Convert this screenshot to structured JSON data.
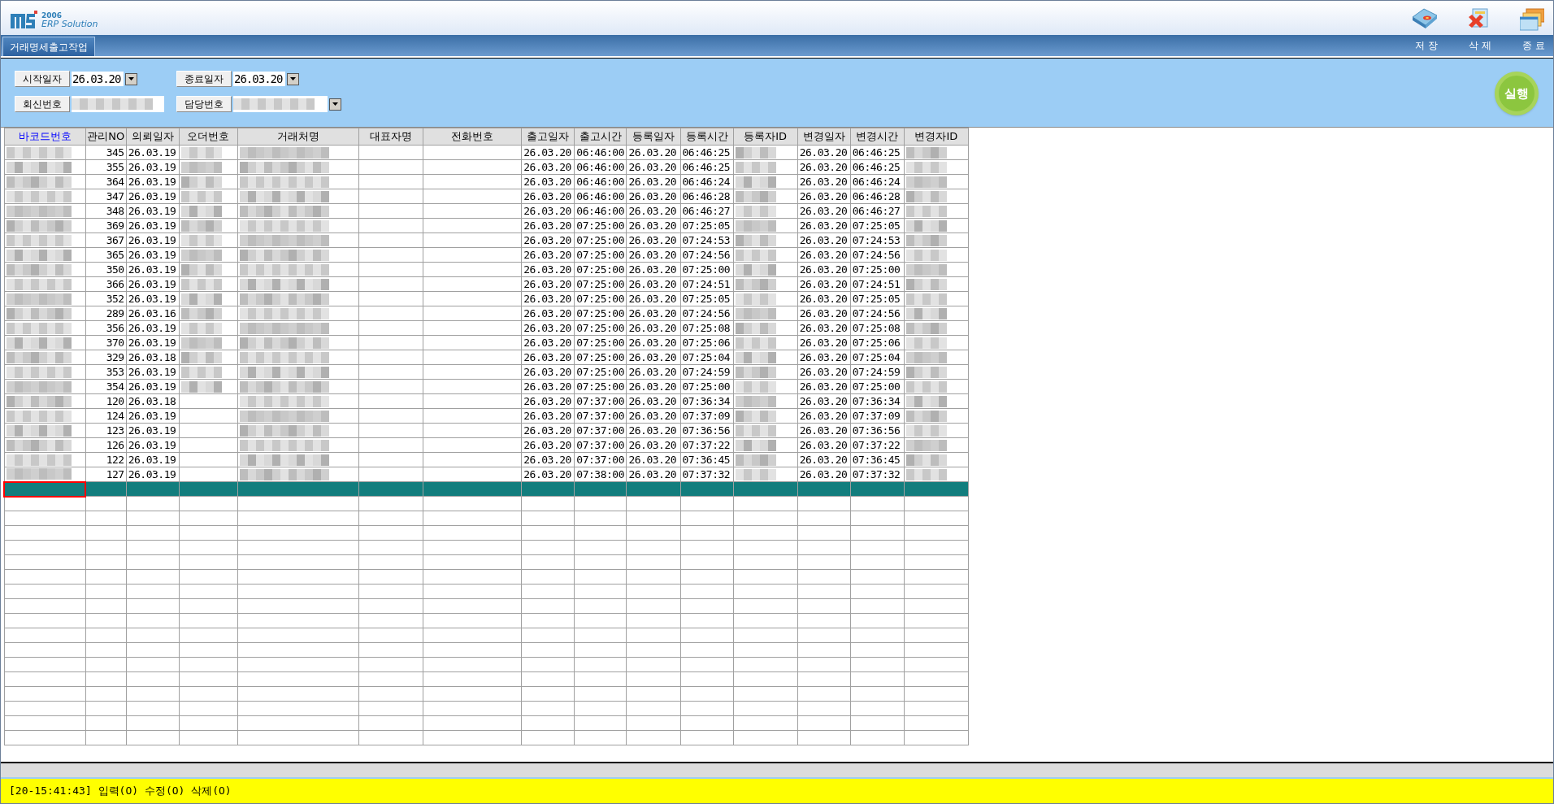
{
  "logo": {
    "year": "2006",
    "text": "ERP Solution"
  },
  "toolbar": [
    {
      "kind": "save",
      "label": "저 장"
    },
    {
      "kind": "delete",
      "label": "삭 제"
    },
    {
      "kind": "exit",
      "label": "종 료"
    }
  ],
  "tab": {
    "label": "거래명세출고작업",
    "selected": true
  },
  "filters": {
    "start_date": {
      "label": "시작일자",
      "value": "26.03.20"
    },
    "end_date": {
      "label": "종료일자",
      "value": "26.03.20"
    },
    "reply_no": {
      "label": "회신번호",
      "masked": true
    },
    "manager_no": {
      "label": "담당번호",
      "masked": true
    }
  },
  "run_button": {
    "label": "실행"
  },
  "table": {
    "columns": [
      {
        "label": "바코드번호",
        "key": true,
        "kind": "masked"
      },
      {
        "label": "관리NO",
        "kind": "number"
      },
      {
        "label": "의뢰일자",
        "kind": "text"
      },
      {
        "label": "오더번호",
        "kind": "order"
      },
      {
        "label": "거래처명",
        "kind": "masked"
      },
      {
        "label": "대표자명",
        "kind": "text"
      },
      {
        "label": "전화번호",
        "kind": "text"
      },
      {
        "label": "출고일자",
        "kind": "text"
      },
      {
        "label": "출고시간",
        "kind": "text"
      },
      {
        "label": "등록일자",
        "kind": "text"
      },
      {
        "label": "등록시간",
        "kind": "text"
      },
      {
        "label": "등록자ID",
        "kind": "masked"
      },
      {
        "label": "변경일자",
        "kind": "text"
      },
      {
        "label": "변경시간",
        "kind": "text"
      },
      {
        "label": "변경자ID",
        "kind": "masked"
      }
    ],
    "rows": [
      {
        "order_masked": true,
        "cells": [
          "",
          "345",
          "26.03.19",
          "",
          "",
          "",
          "",
          "26.03.20",
          "06:46:00",
          "26.03.20",
          "06:46:25",
          "",
          "26.03.20",
          "06:46:25",
          ""
        ]
      },
      {
        "order_masked": true,
        "cells": [
          "",
          "355",
          "26.03.19",
          "",
          "",
          "",
          "",
          "26.03.20",
          "06:46:00",
          "26.03.20",
          "06:46:25",
          "",
          "26.03.20",
          "06:46:25",
          ""
        ]
      },
      {
        "order_masked": true,
        "cells": [
          "",
          "364",
          "26.03.19",
          "",
          "",
          "",
          "",
          "26.03.20",
          "06:46:00",
          "26.03.20",
          "06:46:24",
          "",
          "26.03.20",
          "06:46:24",
          ""
        ]
      },
      {
        "order_masked": true,
        "cells": [
          "",
          "347",
          "26.03.19",
          "",
          "",
          "",
          "",
          "26.03.20",
          "06:46:00",
          "26.03.20",
          "06:46:28",
          "",
          "26.03.20",
          "06:46:28",
          ""
        ]
      },
      {
        "order_masked": true,
        "cells": [
          "",
          "348",
          "26.03.19",
          "",
          "",
          "",
          "",
          "26.03.20",
          "06:46:00",
          "26.03.20",
          "06:46:27",
          "",
          "26.03.20",
          "06:46:27",
          ""
        ]
      },
      {
        "order_masked": true,
        "cells": [
          "",
          "369",
          "26.03.19",
          "",
          "",
          "",
          "",
          "26.03.20",
          "07:25:00",
          "26.03.20",
          "07:25:05",
          "",
          "26.03.20",
          "07:25:05",
          ""
        ]
      },
      {
        "order_masked": true,
        "cells": [
          "",
          "367",
          "26.03.19",
          "",
          "",
          "",
          "",
          "26.03.20",
          "07:25:00",
          "26.03.20",
          "07:24:53",
          "",
          "26.03.20",
          "07:24:53",
          ""
        ]
      },
      {
        "order_masked": true,
        "cells": [
          "",
          "365",
          "26.03.19",
          "",
          "",
          "",
          "",
          "26.03.20",
          "07:25:00",
          "26.03.20",
          "07:24:56",
          "",
          "26.03.20",
          "07:24:56",
          ""
        ]
      },
      {
        "order_masked": true,
        "cells": [
          "",
          "350",
          "26.03.19",
          "",
          "",
          "",
          "",
          "26.03.20",
          "07:25:00",
          "26.03.20",
          "07:25:00",
          "",
          "26.03.20",
          "07:25:00",
          ""
        ]
      },
      {
        "order_masked": true,
        "cells": [
          "",
          "366",
          "26.03.19",
          "",
          "",
          "",
          "",
          "26.03.20",
          "07:25:00",
          "26.03.20",
          "07:24:51",
          "",
          "26.03.20",
          "07:24:51",
          ""
        ]
      },
      {
        "order_masked": true,
        "cells": [
          "",
          "352",
          "26.03.19",
          "",
          "",
          "",
          "",
          "26.03.20",
          "07:25:00",
          "26.03.20",
          "07:25:05",
          "",
          "26.03.20",
          "07:25:05",
          ""
        ]
      },
      {
        "order_masked": true,
        "cells": [
          "",
          "289",
          "26.03.16",
          "",
          "",
          "",
          "",
          "26.03.20",
          "07:25:00",
          "26.03.20",
          "07:24:56",
          "",
          "26.03.20",
          "07:24:56",
          ""
        ]
      },
      {
        "order_masked": true,
        "cells": [
          "",
          "356",
          "26.03.19",
          "",
          "",
          "",
          "",
          "26.03.20",
          "07:25:00",
          "26.03.20",
          "07:25:08",
          "",
          "26.03.20",
          "07:25:08",
          ""
        ]
      },
      {
        "order_masked": true,
        "cells": [
          "",
          "370",
          "26.03.19",
          "",
          "",
          "",
          "",
          "26.03.20",
          "07:25:00",
          "26.03.20",
          "07:25:06",
          "",
          "26.03.20",
          "07:25:06",
          ""
        ]
      },
      {
        "order_masked": true,
        "cells": [
          "",
          "329",
          "26.03.18",
          "",
          "",
          "",
          "",
          "26.03.20",
          "07:25:00",
          "26.03.20",
          "07:25:04",
          "",
          "26.03.20",
          "07:25:04",
          ""
        ]
      },
      {
        "order_masked": true,
        "cells": [
          "",
          "353",
          "26.03.19",
          "",
          "",
          "",
          "",
          "26.03.20",
          "07:25:00",
          "26.03.20",
          "07:24:59",
          "",
          "26.03.20",
          "07:24:59",
          ""
        ]
      },
      {
        "order_masked": true,
        "cells": [
          "",
          "354",
          "26.03.19",
          "",
          "",
          "",
          "",
          "26.03.20",
          "07:25:00",
          "26.03.20",
          "07:25:00",
          "",
          "26.03.20",
          "07:25:00",
          ""
        ]
      },
      {
        "order_masked": false,
        "cells": [
          "",
          "120",
          "26.03.18",
          "",
          "",
          "",
          "",
          "26.03.20",
          "07:37:00",
          "26.03.20",
          "07:36:34",
          "",
          "26.03.20",
          "07:36:34",
          ""
        ]
      },
      {
        "order_masked": false,
        "cells": [
          "",
          "124",
          "26.03.19",
          "",
          "",
          "",
          "",
          "26.03.20",
          "07:37:00",
          "26.03.20",
          "07:37:09",
          "",
          "26.03.20",
          "07:37:09",
          ""
        ]
      },
      {
        "order_masked": false,
        "cells": [
          "",
          "123",
          "26.03.19",
          "",
          "",
          "",
          "",
          "26.03.20",
          "07:37:00",
          "26.03.20",
          "07:36:56",
          "",
          "26.03.20",
          "07:36:56",
          ""
        ]
      },
      {
        "order_masked": false,
        "cells": [
          "",
          "126",
          "26.03.19",
          "",
          "",
          "",
          "",
          "26.03.20",
          "07:37:00",
          "26.03.20",
          "07:37:22",
          "",
          "26.03.20",
          "07:37:22",
          ""
        ]
      },
      {
        "order_masked": false,
        "cells": [
          "",
          "122",
          "26.03.19",
          "",
          "",
          "",
          "",
          "26.03.20",
          "07:37:00",
          "26.03.20",
          "07:36:45",
          "",
          "26.03.20",
          "07:36:45",
          ""
        ]
      },
      {
        "order_masked": false,
        "cells": [
          "",
          "127",
          "26.03.19",
          "",
          "",
          "",
          "",
          "26.03.20",
          "07:38:00",
          "26.03.20",
          "07:37:32",
          "",
          "26.03.20",
          "07:37:32",
          ""
        ]
      }
    ],
    "new_row": {
      "selected": true
    }
  },
  "status_bar": {
    "text": "[20-15:41:43] 입력(O) 수정(O) 삭제(O)"
  }
}
